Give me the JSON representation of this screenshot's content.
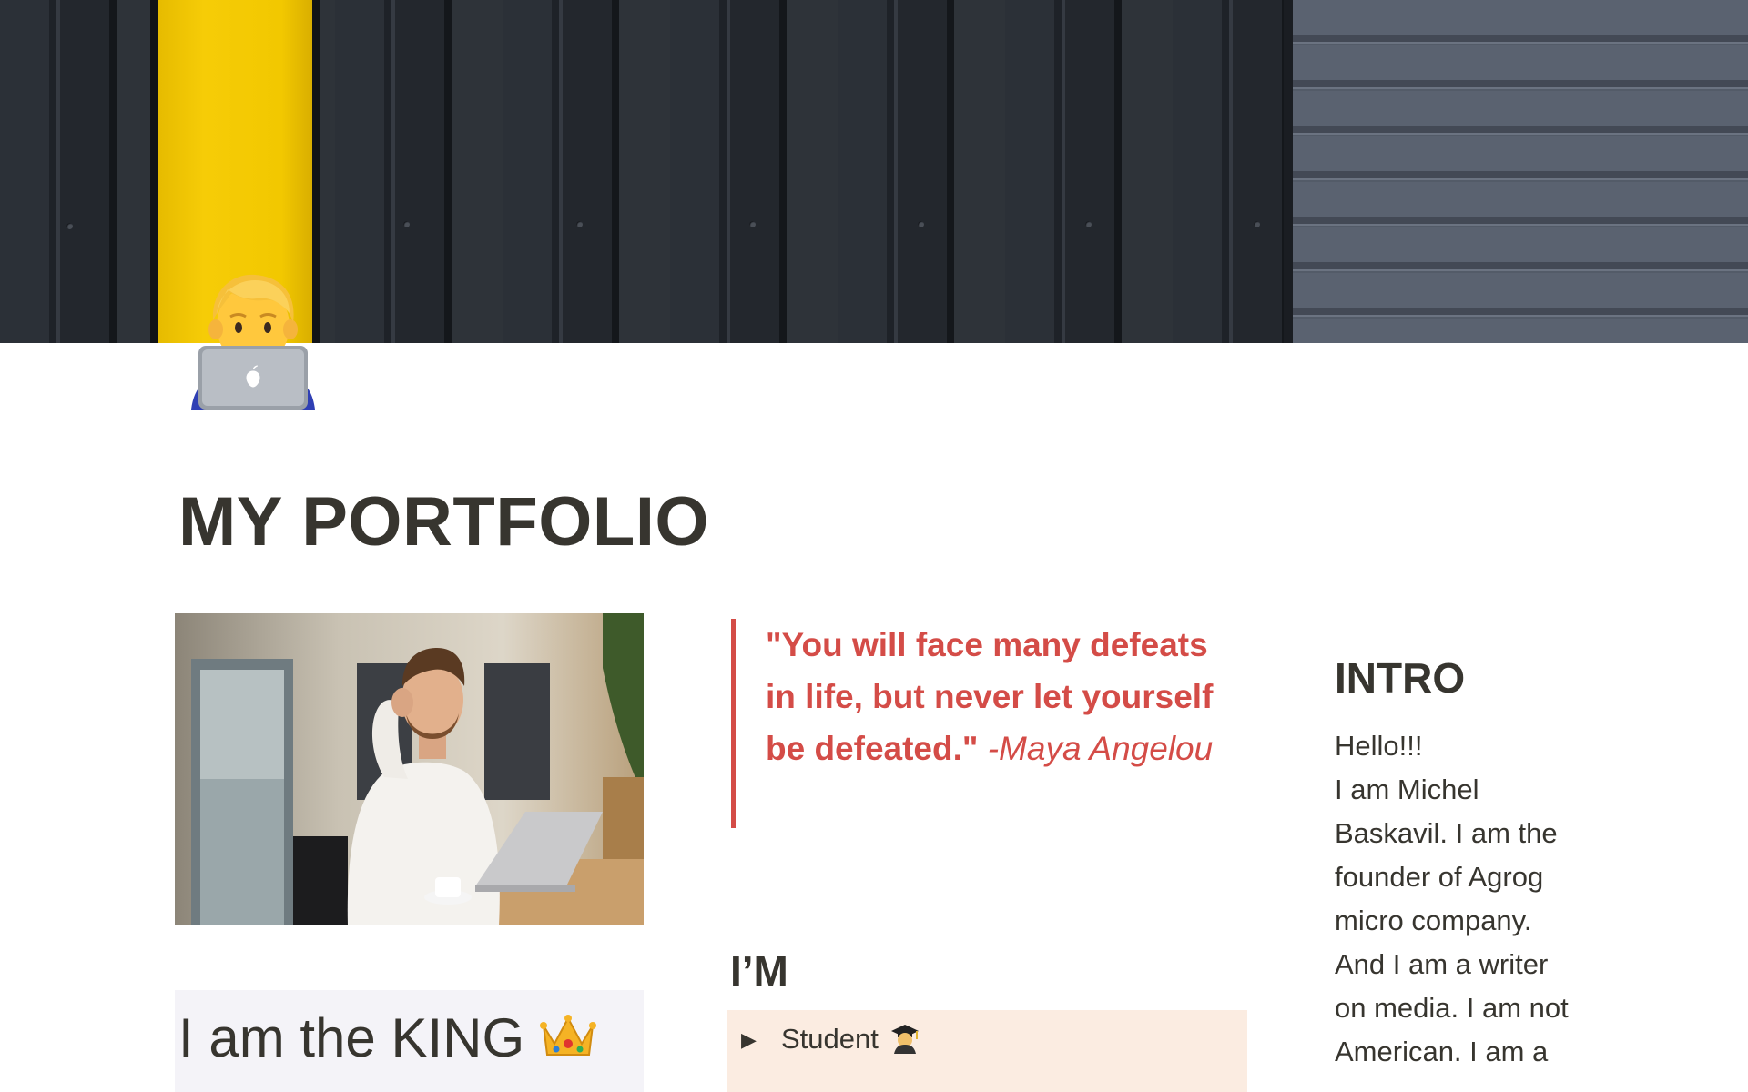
{
  "page": {
    "title": "MY PORTFOLIO",
    "icon": "man-technologist-icon"
  },
  "cover": {
    "description_colors": {
      "accent_yellow": "#f2c800",
      "dark_metal": "#23272d",
      "siding": "#5a6270"
    }
  },
  "quote": {
    "text": "\"You will face many defeats in life, but never let yourself be defeated.\"",
    "author": "-Maya Angelou",
    "color": "#d44c47"
  },
  "king": {
    "text": "I am the KING",
    "icon": "crown-icon"
  },
  "im_section": {
    "heading": "I’M",
    "toggle_label": "Student",
    "toggle_icon": "graduate-icon"
  },
  "intro": {
    "heading": "INTRO",
    "lines": [
      "Hello!!!",
      "I am Michel",
      "Baskavil. I am the",
      "founder of Agrog",
      "micro company.",
      "And I am a writer",
      "on media. I am not",
      "American. I am a"
    ]
  }
}
